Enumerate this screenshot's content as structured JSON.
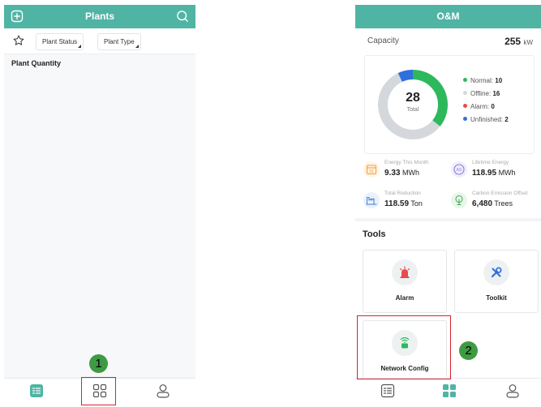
{
  "left_screen": {
    "header": {
      "title": "Plants",
      "add_icon": "plus-square-icon",
      "search_icon": "search-icon"
    },
    "filters": {
      "favorite_icon": "star-icon",
      "plant_status": "Plant Status",
      "plant_type": "Plant Type"
    },
    "section_title": "Plant Quantity",
    "tabbar": [
      {
        "icon": "list-icon",
        "active": true
      },
      {
        "icon": "grid-icon",
        "active": false
      },
      {
        "icon": "user-icon",
        "active": false
      }
    ],
    "step_badge": "1"
  },
  "right_screen": {
    "header": {
      "title": "O&M"
    },
    "capacity": {
      "label": "Capacity",
      "value": "255",
      "unit": "kW"
    },
    "donut": {
      "total_value": "28",
      "total_label": "Total",
      "segments": [
        {
          "name": "Normal",
          "value": 10,
          "color": "#2eb85c"
        },
        {
          "name": "Offline",
          "value": 16,
          "color": "#d4d7db"
        },
        {
          "name": "Alarm",
          "value": 0,
          "color": "#e84b4b"
        },
        {
          "name": "Unfinished",
          "value": 2,
          "color": "#2f6fe0"
        }
      ]
    },
    "legend": [
      {
        "label": "Normal:",
        "value": "10",
        "color": "#2eb85c"
      },
      {
        "label": "Offline:",
        "value": "16",
        "color": "#d4d7db"
      },
      {
        "label": "Alarm:",
        "value": "0",
        "color": "#e84b4b"
      },
      {
        "label": "Unfinished:",
        "value": "2",
        "color": "#2f6fe0"
      }
    ],
    "metrics": [
      {
        "title": "Energy This Month",
        "value": "9.33",
        "unit": "MWh",
        "icon": "calendar-icon"
      },
      {
        "title": "Lifetime Energy",
        "value": "118.95",
        "unit": "MWh",
        "icon": "sigma-icon"
      },
      {
        "title": "Total Reduction",
        "value": "118.59",
        "unit": "Ton",
        "icon": "factory-icon"
      },
      {
        "title": "Carbon Emission Offset",
        "value": "6,480",
        "unit": "Trees",
        "icon": "tree-icon"
      }
    ],
    "tools_title": "Tools",
    "tools": [
      {
        "label": "Alarm",
        "icon": "alarm-light-icon"
      },
      {
        "label": "Toolkit",
        "icon": "tools-icon"
      },
      {
        "label": "Network Config",
        "icon": "router-icon"
      }
    ],
    "tabbar": [
      {
        "icon": "list-icon",
        "active": false
      },
      {
        "icon": "grid-icon",
        "active": true
      },
      {
        "icon": "user-icon",
        "active": false
      }
    ],
    "step_badge": "2"
  },
  "colors": {
    "accent": "#4fb4a4",
    "highlight": "#d9232d",
    "badge": "#3f9a44"
  }
}
